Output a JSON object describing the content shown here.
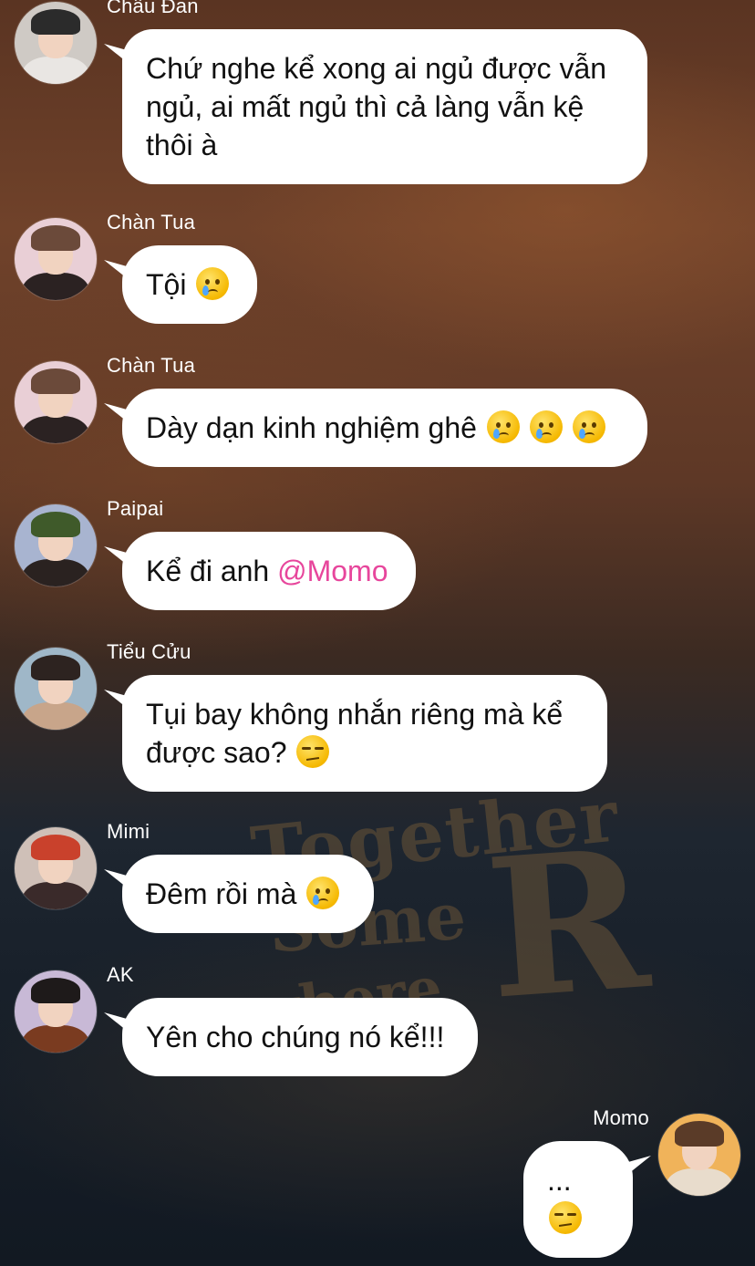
{
  "messages": [
    {
      "sender": "Châu Đan",
      "parts": [
        {
          "text": "Chứ nghe kể xong ai ngủ được vẫn ngủ, ai mất ngủ thì cả làng vẫn kệ thôi à"
        }
      ],
      "avatar_colors": {
        "hair": "#2b2b2b",
        "body": "#e9e6e3",
        "bg": "#cfcac5"
      }
    },
    {
      "sender": "Chàn Tua",
      "parts": [
        {
          "text": "Tội "
        },
        {
          "emoji": "crying-face-icon"
        }
      ],
      "avatar_colors": {
        "hair": "#6b4a3a",
        "body": "#2b2222",
        "bg": "#e9cfd6"
      }
    },
    {
      "sender": "Chàn Tua",
      "parts": [
        {
          "text": "Dày dạn kinh nghiệm ghê "
        },
        {
          "emoji": "crying-face-icon"
        },
        {
          "emoji": "crying-face-icon"
        },
        {
          "emoji": "crying-face-icon"
        }
      ],
      "avatar_colors": {
        "hair": "#6b4a3a",
        "body": "#2b2222",
        "bg": "#e9cfd6"
      }
    },
    {
      "sender": "Paipai",
      "parts": [
        {
          "text": "Kể đi anh "
        },
        {
          "mention": "@Momo"
        }
      ],
      "avatar_colors": {
        "hair": "#3f5a2a",
        "body": "#2a2220",
        "bg": "#a8b4d0"
      }
    },
    {
      "sender": "Tiểu Cửu",
      "parts": [
        {
          "text": "Tụi bay không nhắn riêng mà kể được sao? "
        },
        {
          "emoji": "unamused-face-icon"
        }
      ],
      "avatar_colors": {
        "hair": "#2d2320",
        "body": "#c8a58a",
        "bg": "#9fb7c8"
      }
    },
    {
      "sender": "Mimi",
      "parts": [
        {
          "text": "Đêm rồi mà "
        },
        {
          "emoji": "crying-face-icon"
        }
      ],
      "avatar_colors": {
        "hair": "#c9412c",
        "body": "#3a2a2a",
        "bg": "#cfc0b8"
      }
    },
    {
      "sender": "AK",
      "parts": [
        {
          "text": "Yên cho chúng nó kể!!!"
        }
      ],
      "avatar_colors": {
        "hair": "#1e1a1a",
        "body": "#7a3b20",
        "bg": "#c8b9d6"
      }
    },
    {
      "sender": "Momo",
      "own": true,
      "parts": [
        {
          "text": "..."
        },
        {
          "emoji": "unamused-face-icon"
        }
      ],
      "avatar_colors": {
        "hair": "#5a3b28",
        "body": "#e8dccc",
        "bg": "#f0b35a"
      }
    }
  ],
  "background_text": [
    "Together",
    "Some",
    "where",
    "R"
  ]
}
